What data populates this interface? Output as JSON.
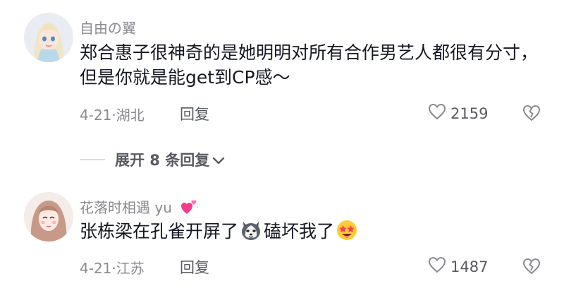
{
  "comments": [
    {
      "username": "自由の翼",
      "text": "郑合惠子很神奇的是她明明对所有合作男艺人都很有分寸，但是你就是能get到CP感～",
      "date": "4-21",
      "location": "湖北",
      "reply_label": "回复",
      "likes": "2159"
    },
    {
      "username": "花落时相遇 yu",
      "text_part1": "张栋梁在孔雀开屏了",
      "text_part2": "磕坏我了",
      "date": "4-21",
      "location": "江苏",
      "reply_label": "回复",
      "likes": "1487"
    }
  ],
  "expand_replies": {
    "label": "展开 8 条回复"
  },
  "icons": {
    "like": "heart-outline-icon",
    "dislike": "broken-heart-icon",
    "expand": "chevron-down-icon",
    "username_badge": "sparkling-hearts-icon",
    "emoji_dog": "husky-dog-emoji-icon",
    "emoji_star": "star-struck-face-emoji-icon"
  },
  "colors": {
    "primary_text": "#161823",
    "secondary_text": "#8a8b91",
    "action_text": "#595b63"
  }
}
